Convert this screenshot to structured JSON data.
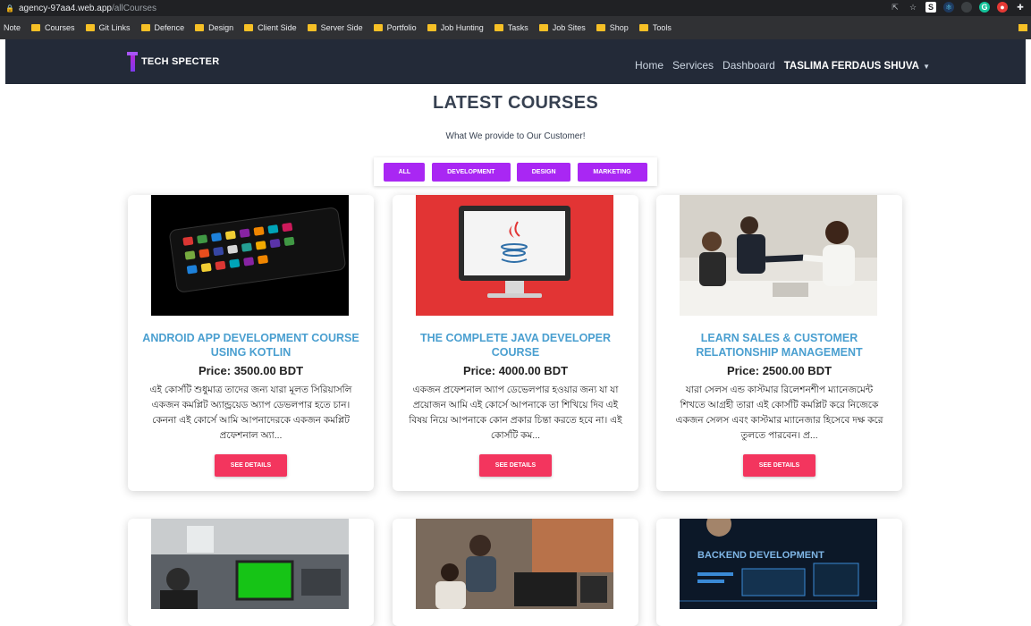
{
  "browser": {
    "url_host": "agency-97aa4.web.app",
    "url_path": "/allCourses",
    "bookmarks": [
      "Courses",
      "Git Links",
      "Defence",
      "Design",
      "Client Side",
      "Server Side",
      "Portfolio",
      "Job Hunting",
      "Tasks",
      "Job Sites",
      "Shop",
      "Tools"
    ],
    "bookmark_note": "Note"
  },
  "navbar": {
    "brand": "TECH SPECTER",
    "links": [
      "Home",
      "Services",
      "Dashboard"
    ],
    "user": "TASLIMA FERDAUS SHUVA"
  },
  "page": {
    "title": "LATEST COURSES",
    "subtitle": "What We provide to Our Customer!",
    "filters": [
      "ALL",
      "DEVELOPMENT",
      "DESIGN",
      "MARKETING"
    ]
  },
  "courses": [
    {
      "title": "ANDROID APP DEVELOPMENT COURSE USING KOTLIN",
      "price": "Price: 3500.00 BDT",
      "description": "এই কোর্সটি শুধুমাত্র তাদের জন্য যারা মূলত সিরিয়াসলি একজন কমপ্লিট অ্যান্ড্রয়েড অ্যাপ ডেভলপার হতে চান। কেননা এই কোর্সে আমি আপনাদেরকে একজন কমপ্লিট প্রফেশনাল অ্যা...",
      "button": "SEE DETAILS"
    },
    {
      "title": "THE COMPLETE JAVA DEVELOPER COURSE",
      "price": "Price: 4000.00 BDT",
      "description": "একজন প্রফেশনাল অ্যাপ ডেভেলপার হওয়ার জন্য যা যা প্রয়োজন আমি এই কোর্সে আপনাকে তা শিখিয়ে দিব এই বিষয় নিয়ে আপনাকে কোন প্রকার চিন্তা করতে হবে না। এই কোর্সটি কম...",
      "button": "SEE DETAILS"
    },
    {
      "title": "LEARN SALES & CUSTOMER RELATIONSHIP MANAGEMENT",
      "price": "Price: 2500.00 BDT",
      "description": "যারা সেলস এন্ড কাস্টমার রিলেশনশীপ ম্যানেজমেন্ট শিখতে আগ্রহী তারা এই কোর্সটি কমপ্লিট করে নিজেকে একজন সেলস এবং কাস্টমার ম্যানেজার হিসেবে দক্ষ করে তুলতে পারবেন। প্র...",
      "button": "SEE DETAILS"
    }
  ],
  "bottom_images": [
    "media-editing",
    "office-team",
    "backend-development"
  ],
  "backend_image_text": "BACKEND DEVELOPMENT"
}
